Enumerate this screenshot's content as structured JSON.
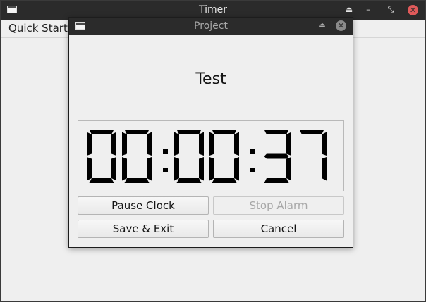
{
  "main_window": {
    "title": "Timer",
    "menu": {
      "quick_start": "Quick Start"
    },
    "controls": {
      "shade": "⏏",
      "minimize": "–",
      "maximize": "⤡",
      "close": "✕"
    }
  },
  "dialog": {
    "title": "Project",
    "controls": {
      "shade": "⏏",
      "close": "✕"
    },
    "project_name": "Test",
    "clock": {
      "hours": "00",
      "minutes": "00",
      "seconds": "37",
      "separator": ":"
    },
    "buttons": {
      "pause_clock": "Pause Clock",
      "stop_alarm": "Stop Alarm",
      "save_exit": "Save & Exit",
      "cancel": "Cancel"
    }
  },
  "colors": {
    "titlebar": "#2b2b2b",
    "window_bg": "#efefef",
    "close_red": "#e05a5a",
    "lcd_digit": "#000000"
  }
}
